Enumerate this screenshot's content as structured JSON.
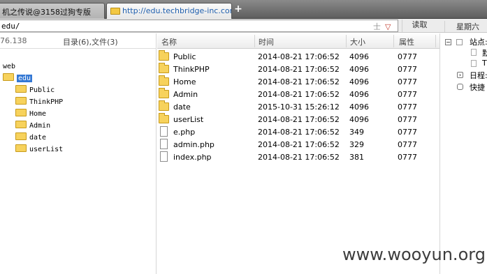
{
  "tabs": [
    {
      "label": "机之传说@3158过狗专版",
      "active": false
    },
    {
      "label": "http://edu.techbridge-inc.com...",
      "active": true
    }
  ],
  "newtab_symbol": "+",
  "toolbar": {
    "path": "edu/",
    "pin_symbol": "士",
    "dropdown_symbol": "▽",
    "read_label": "读取",
    "weekday": "星期六"
  },
  "left_panel": {
    "ip": "76.138",
    "counts": "目录(6),文件(3)",
    "tree": {
      "root": "web",
      "selected": "edu",
      "children": [
        "Public",
        "ThinkPHP",
        "Home",
        "Admin",
        "date",
        "userList"
      ]
    }
  },
  "file_list": {
    "columns": [
      "名称",
      "时间",
      "大小",
      "属性"
    ],
    "rows": [
      {
        "name": "Public",
        "time": "2014-08-21 17:06:52",
        "size": "4096",
        "attr": "0777",
        "type": "folder"
      },
      {
        "name": "ThinkPHP",
        "time": "2014-08-21 17:06:52",
        "size": "4096",
        "attr": "0777",
        "type": "folder"
      },
      {
        "name": "Home",
        "time": "2014-08-21 17:06:52",
        "size": "4096",
        "attr": "0777",
        "type": "folder"
      },
      {
        "name": "Admin",
        "time": "2014-08-21 17:06:52",
        "size": "4096",
        "attr": "0777",
        "type": "folder"
      },
      {
        "name": "date",
        "time": "2015-10-31 15:26:12",
        "size": "4096",
        "attr": "0777",
        "type": "folder"
      },
      {
        "name": "userList",
        "time": "2014-08-21 17:06:52",
        "size": "4096",
        "attr": "0777",
        "type": "folder"
      },
      {
        "name": "e.php",
        "time": "2014-08-21 17:06:52",
        "size": "349",
        "attr": "0777",
        "type": "file"
      },
      {
        "name": "admin.php",
        "time": "2014-08-21 17:06:52",
        "size": "329",
        "attr": "0777",
        "type": "file"
      },
      {
        "name": "index.php",
        "time": "2014-08-21 17:06:52",
        "size": "381",
        "attr": "0777",
        "type": "file"
      }
    ]
  },
  "right_panel": {
    "items": [
      {
        "label": "站点:",
        "icon": "expand-box-icon"
      },
      {
        "label": "默",
        "icon": "page-icon"
      },
      {
        "label": "T",
        "icon": "page-icon"
      },
      {
        "label": "日程:",
        "icon": "calendar-icon"
      },
      {
        "label": "快捷",
        "icon": "hand-icon"
      }
    ]
  },
  "watermark": "www.wooyun.org",
  "colors": {
    "selection": "#3478d4",
    "folder": "#f7d25c",
    "active_tab_text": "#1f5fae"
  }
}
